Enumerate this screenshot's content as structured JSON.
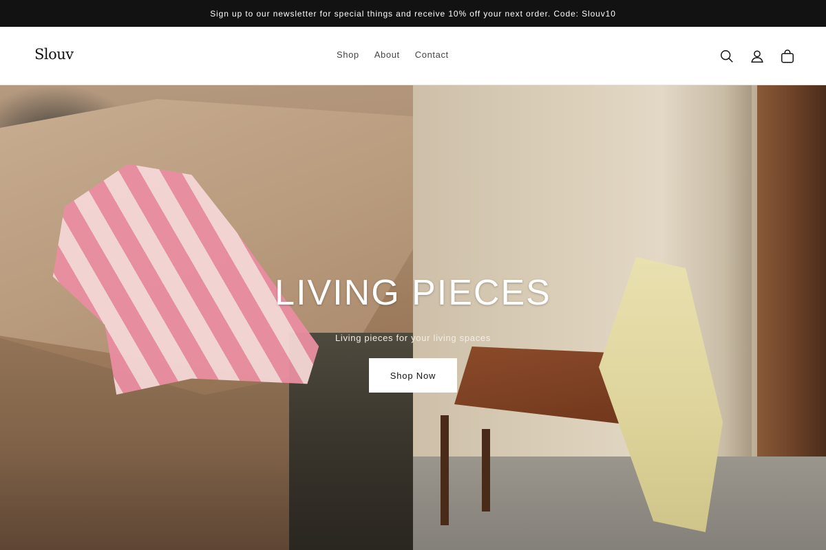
{
  "announcement": {
    "text": "Sign up to our newsletter for special things and receive 10% off your next order. Code: Slouv10"
  },
  "header": {
    "logo": "Slouv",
    "nav": [
      {
        "label": "Shop"
      },
      {
        "label": "About"
      },
      {
        "label": "Contact"
      }
    ],
    "icons": [
      "search-icon",
      "account-icon",
      "cart-icon"
    ]
  },
  "hero": {
    "title": "LIVING PIECES",
    "subtitle": "Living pieces for your living spaces",
    "button_label": "Shop Now"
  },
  "colors": {
    "announcement_bg": "#121212",
    "announcement_text": "#ffffff",
    "header_bg": "#ffffff",
    "button_bg": "#ffffff",
    "hero_title": "#ffffff"
  }
}
